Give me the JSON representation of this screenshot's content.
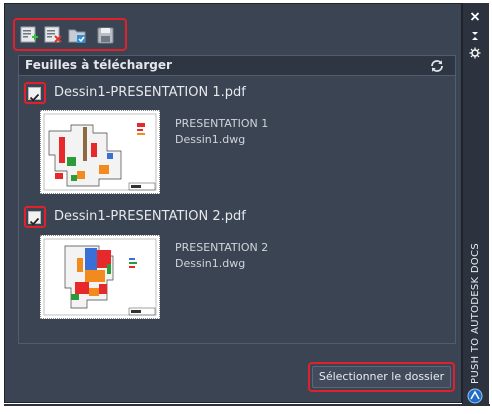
{
  "palette": {
    "title": "PUSH TO AUTODESK DOCS",
    "toolbar": {
      "buttons": [
        {
          "name": "add-sheets-button",
          "icon": "add-sheet-icon"
        },
        {
          "name": "remove-sheets-button",
          "icon": "remove-sheet-icon"
        },
        {
          "name": "open-folder-button",
          "icon": "folder-icon"
        },
        {
          "name": "save-button",
          "icon": "save-icon"
        }
      ]
    },
    "list": {
      "header": "Feuilles à télécharger",
      "refresh_icon": "refresh-icon",
      "items": [
        {
          "checked": true,
          "file": "Dessin1-PRESENTATION 1.pdf",
          "layout": "PRESENTATION 1",
          "drawing": "Dessin1.dwg"
        },
        {
          "checked": true,
          "file": "Dessin1-PRESENTATION 2.pdf",
          "layout": "PRESENTATION 2",
          "drawing": "Dessin1.dwg"
        }
      ]
    },
    "select_folder_label": "Sélectionner le dossier"
  },
  "colors": {
    "panel_bg": "#3b4453",
    "strip_bg": "#2c333e",
    "highlight": "#e0202b",
    "text": "#e6e8ec"
  }
}
